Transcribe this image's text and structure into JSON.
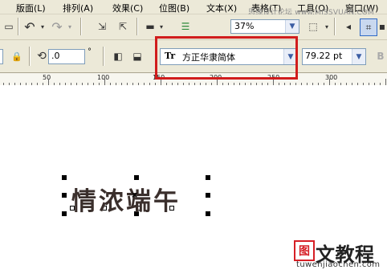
{
  "menu": {
    "items": [
      "版面(L)",
      "排列(A)",
      "效果(C)",
      "位图(B)",
      "文本(X)",
      "表格(T)",
      "工具(O)",
      "窗口(W)"
    ],
    "overlay_watermark": "思缘设计论坛 www.MISSVUAN.COM"
  },
  "toolbar1": {
    "zoom_value": "37%"
  },
  "toolbar2": {
    "rotation_value": ".0",
    "rotation_unit": "°",
    "font_icon": "Tr",
    "font_name": "方正华隶简体",
    "font_size": "79.22 pt"
  },
  "ruler": {
    "labels": [
      "50",
      "100",
      "150",
      "200",
      "250",
      "300"
    ]
  },
  "canvas": {
    "text": "情浓端午",
    "center_marker": "×"
  },
  "watermark": {
    "logo_char": "图",
    "title": "文教程",
    "url": "tuwenjiaochen.com"
  },
  "colors": {
    "highlight": "#d11d1d",
    "ui_bg": "#ece9d8"
  }
}
